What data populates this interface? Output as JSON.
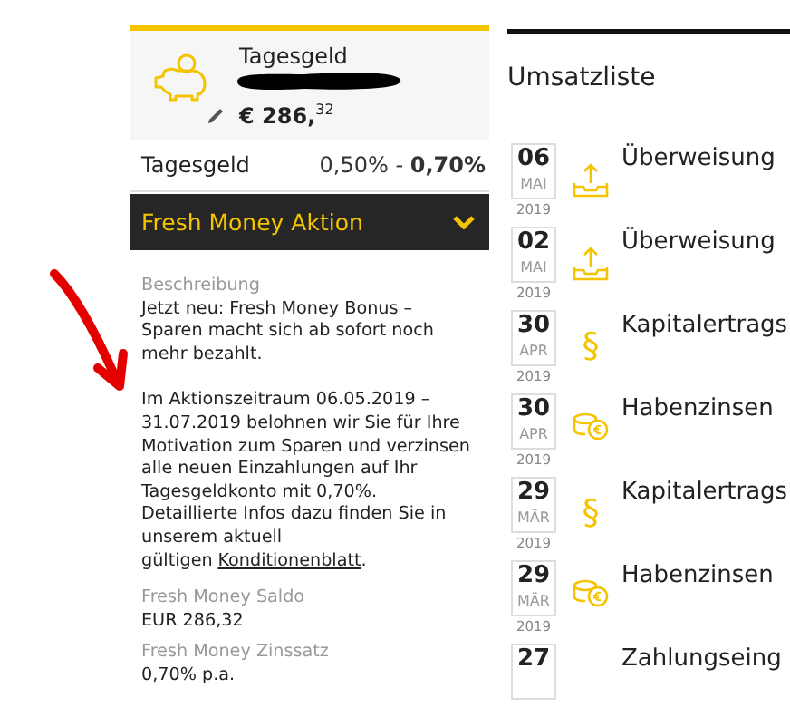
{
  "account": {
    "type": "Tagesgeld",
    "balance_main": "€ 286,",
    "balance_cents": "32",
    "rate_label": "Tagesgeld",
    "rate_text": "0,50% - **0,70%**"
  },
  "promo": {
    "title": "Fresh Money Aktion",
    "expanded": true
  },
  "details": [
    {
      "label": "Beschreibung",
      "paragraphs": [
        "Jetzt neu: Fresh Money Bonus – Sparen macht sich ab sofort noch mehr bezahlt.",
        "Im Aktionszeitraum 06.05.2019 – 31.07.2019 belohnen wir Sie für Ihre Motivation zum Sparen und verzinsen alle neuen Einzahlungen auf Ihr Tagesgeldkonto mit 0,70%. Detaillierte Infos dazu finden Sie in unserem aktuell gültigen"
      ],
      "link": "Konditionenblatt",
      "link_suffix": "."
    },
    {
      "label": "Fresh Money Saldo",
      "value": "EUR 286,32"
    },
    {
      "label": "Fresh Money Zinssatz",
      "value": "0,70% p.a."
    }
  ],
  "transactions": {
    "title": "Umsatzliste",
    "rows": [
      {
        "day": "06",
        "month": "MAI",
        "year": "2019",
        "kind": "transfer",
        "text": "Überweisung"
      },
      {
        "day": "02",
        "month": "MAI",
        "year": "2019",
        "kind": "transfer",
        "text": "Überweisung"
      },
      {
        "day": "30",
        "month": "APR",
        "year": "2019",
        "kind": "tax",
        "symbol": "§",
        "text": "Kapitalertrags"
      },
      {
        "day": "30",
        "month": "APR",
        "year": "2019",
        "kind": "interest",
        "text": "Habenzinsen"
      },
      {
        "day": "29",
        "month": "MÄR",
        "year": "2019",
        "kind": "tax",
        "symbol": "§",
        "text": "Kapitalertrags"
      },
      {
        "day": "29",
        "month": "MÄR",
        "year": "2019",
        "kind": "interest",
        "text": "Habenzinsen"
      },
      {
        "day": "27",
        "text": "Zahlungseing"
      }
    ]
  }
}
